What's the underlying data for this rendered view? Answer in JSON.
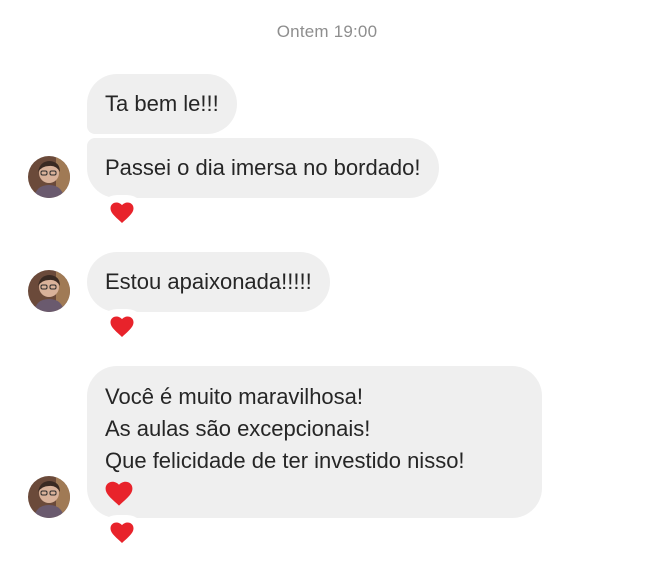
{
  "thread": {
    "timestamp": "Ontem 19:00"
  },
  "messages": [
    {
      "lines": [
        "Ta bem le!!!"
      ],
      "reaction": null
    },
    {
      "lines": [
        "Passei o dia imersa no bordado!"
      ],
      "reaction": "heart-icon"
    },
    {
      "lines": [
        "Estou apaixonada!!!!!"
      ],
      "reaction": "heart-icon"
    },
    {
      "lines": [
        "Você é muito maravilhosa!",
        "As aulas são excepcionais!",
        "Que felicidade de ter investido nisso!"
      ],
      "inline_emoji": "heart-icon",
      "reaction": "heart-icon"
    }
  ],
  "colors": {
    "bubble": "#efefef",
    "text": "#262626",
    "timestamp": "#8e8e8e",
    "heart": "#e8232b"
  }
}
